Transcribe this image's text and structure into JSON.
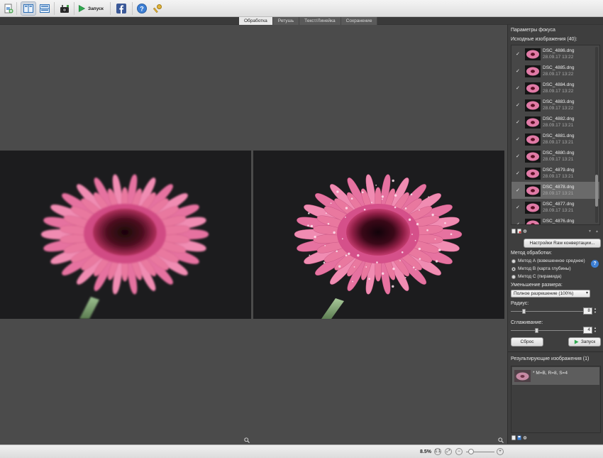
{
  "toolbar": {
    "run_label": "Запуск",
    "icons": [
      "add-images-icon",
      "split-view-icon",
      "stacked-view-icon",
      "camera-icon",
      "run-icon",
      "facebook-icon",
      "help-icon",
      "key-icon"
    ]
  },
  "tabs": [
    {
      "label": "Обработка",
      "active": true
    },
    {
      "label": "Ретушь",
      "active": false
    },
    {
      "label": "Текст/Линейка",
      "active": false
    },
    {
      "label": "Сохранение",
      "active": false
    }
  ],
  "sidebar": {
    "focus_title": "Параметры фокуса",
    "sources_title": "Исходные изображения (40):",
    "sources": [
      {
        "name": "DSC_4886.dng",
        "date": "28.09.17 13:22",
        "checked": true,
        "selected": false
      },
      {
        "name": "DSC_4885.dng",
        "date": "28.09.17 13:22",
        "checked": true,
        "selected": false
      },
      {
        "name": "DSC_4884.dng",
        "date": "28.09.17 13:22",
        "checked": true,
        "selected": false
      },
      {
        "name": "DSC_4883.dng",
        "date": "28.09.17 13:22",
        "checked": true,
        "selected": false
      },
      {
        "name": "DSC_4882.dng",
        "date": "28.09.17 13:21",
        "checked": true,
        "selected": false
      },
      {
        "name": "DSC_4881.dng",
        "date": "28.09.17 13:21",
        "checked": true,
        "selected": false
      },
      {
        "name": "DSC_4880.dng",
        "date": "28.09.17 13:21",
        "checked": true,
        "selected": false
      },
      {
        "name": "DSC_4879.dng",
        "date": "28.09.17 13:21",
        "checked": true,
        "selected": false
      },
      {
        "name": "DSC_4878.dng",
        "date": "28.09.17 13:21",
        "checked": true,
        "selected": true
      },
      {
        "name": "DSC_4877.dng",
        "date": "28.09.17 13:21",
        "checked": true,
        "selected": false
      },
      {
        "name": "DSC_4876.dng",
        "date": "28.09.17 13:21",
        "checked": true,
        "selected": false
      }
    ],
    "raw_button": "Настройки Raw конвертации...",
    "method_title": "Метод обработки:",
    "methods": [
      {
        "label": "Метод А (взвешенное среднее)",
        "selected": false
      },
      {
        "label": "Метод В (карта глубины)",
        "selected": true
      },
      {
        "label": "Метод С (пирамида)",
        "selected": false
      }
    ],
    "downsize_title": "Уменьшение размера:",
    "downsize_value": "Полное разрешение (100%)",
    "radius_title": "Радиус:",
    "radius_value": "8",
    "smoothing_title": "Сглаживание:",
    "smoothing_value": "4",
    "reset_button": "Сброс",
    "run_button": "Запуск",
    "results_title": "Результирующие изображения (1)",
    "results": [
      {
        "label": "* M=B, R=8, S=4"
      }
    ]
  },
  "statusbar": {
    "zoom": "8.5%",
    "zoom_level": 0.1
  },
  "colors": {
    "petal": "#e46b9c",
    "center": "#7a1a36",
    "accent_run": "#2fa84f",
    "facebook": "#3b5998"
  }
}
